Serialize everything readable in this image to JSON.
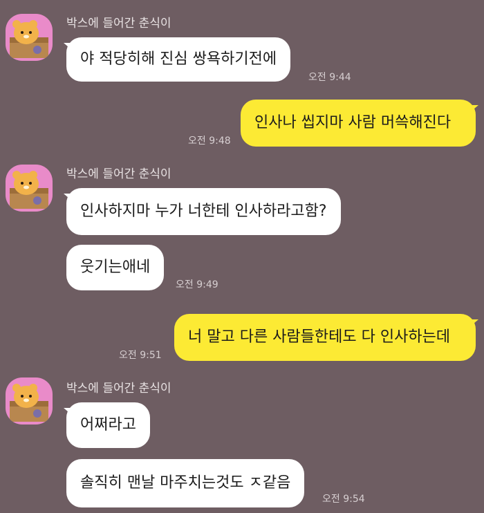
{
  "colors": {
    "background": "#6e5d62",
    "incoming_bubble": "#ffffff",
    "outgoing_bubble": "#fcea34",
    "avatar_background": "#e98bc9"
  },
  "avatar_icon": "bear-in-box-icon",
  "messages": [
    {
      "sender": "박스에 들어간 춘식이",
      "text": "야 적당히해 진심 쌍욕하기전에",
      "time": "오전 9:44"
    },
    {
      "sender": "me",
      "text": "인사나 씹지마 사람 머쓱해진다",
      "time": "오전 9:48"
    },
    {
      "sender": "박스에 들어간 춘식이",
      "text": "인사하지마 누가 너한테 인사하라고함?"
    },
    {
      "sender": "박스에 들어간 춘식이",
      "text": "웃기는애네",
      "time": "오전 9:49"
    },
    {
      "sender": "me",
      "text": "너 말고 다른 사람들한테도 다 인사하는데",
      "time": "오전 9:51"
    },
    {
      "sender": "박스에 들어간 춘식이",
      "text": "어쩌라고"
    },
    {
      "sender": "박스에 들어간 춘식이",
      "text": "솔직히 맨날 마주치는것도 ㅈ같음",
      "time": "오전 9:54"
    }
  ]
}
